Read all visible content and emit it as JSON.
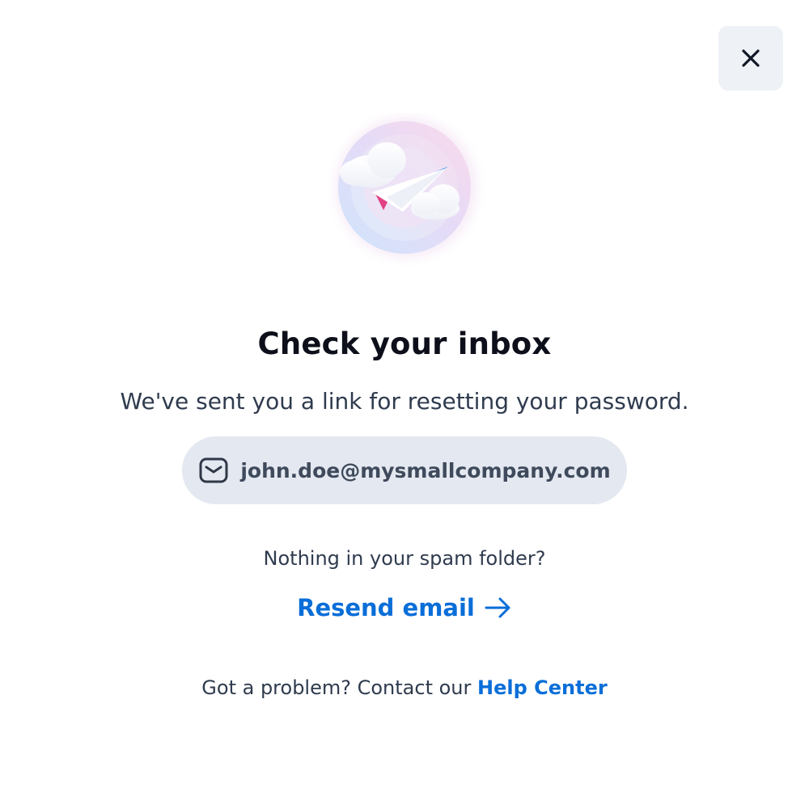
{
  "header": {
    "close_icon": "close-icon"
  },
  "illustration": {
    "icon": "paper-plane-icon"
  },
  "content": {
    "title": "Check your inbox",
    "subtitle": "We've sent you a link for resetting your password.",
    "email": "john.doe@mysmallcompany.com",
    "email_icon": "mail-icon",
    "spam_question": "Nothing in your spam folder?",
    "resend_label": "Resend email",
    "resend_icon": "arrow-right-icon"
  },
  "footer": {
    "help_prefix": "Got a problem? Contact our ",
    "help_link": "Help Center"
  },
  "colors": {
    "accent": "#0a6ed8",
    "pill_bg": "#e4e8f0",
    "close_bg": "#eef1f6",
    "title": "#0d0f1a",
    "body_text": "#2f3b4e"
  }
}
